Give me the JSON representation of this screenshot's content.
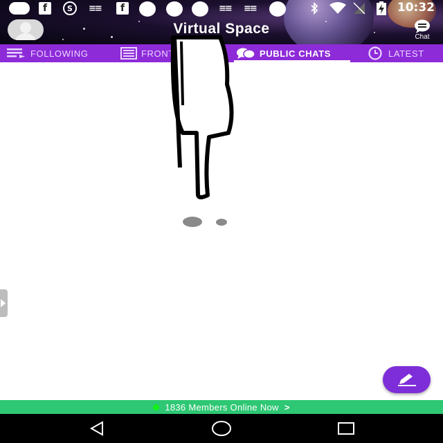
{
  "status_bar": {
    "time": "10:32",
    "icons": [
      "message-icon",
      "facebook-icon",
      "s-app-icon",
      "bird-app-icon",
      "facebook-icon",
      "notification-dot-icon",
      "notification-dot-icon",
      "notification-dot-icon",
      "bird-app-icon",
      "bird-app-icon",
      "notification-dot-icon",
      "bluetooth-icon",
      "wifi-icon",
      "no-signal-icon",
      "battery-charging-icon"
    ]
  },
  "app_bar": {
    "title": "Virtual Space",
    "chat_label": "Chat"
  },
  "tabs": [
    {
      "label": "FOLLOWING",
      "icon": "list-icon",
      "active": false
    },
    {
      "label": "FRONT PAGE",
      "icon": "newspaper-icon",
      "active": false
    },
    {
      "label": "PUBLIC CHATS",
      "icon": "chat-bubbles-icon",
      "active": true
    },
    {
      "label": "LATEST",
      "icon": "clock-icon",
      "active": false
    }
  ],
  "members_bar": {
    "text": "1836 Members Online Now",
    "chevron": ">"
  },
  "colors": {
    "tab_bar": "#8e2bd9",
    "fab": "#7e2ed8",
    "members_bar": "#2ec773",
    "online_dot": "#13f01a"
  },
  "nav": [
    "back-icon",
    "home-icon",
    "recents-icon"
  ]
}
